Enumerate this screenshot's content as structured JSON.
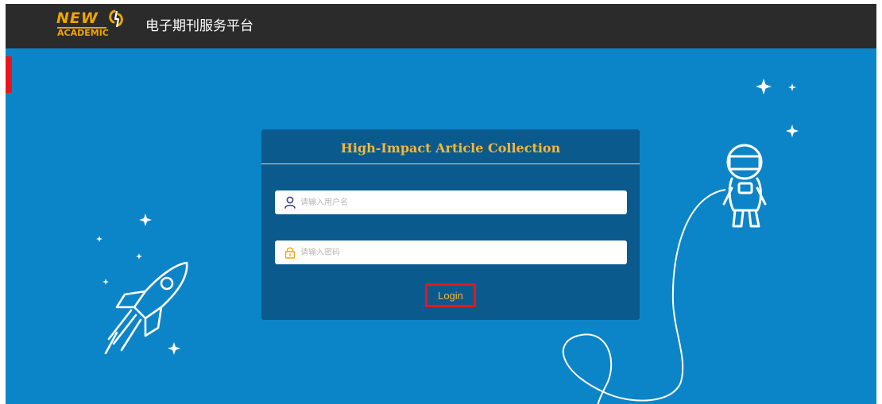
{
  "header": {
    "logo": {
      "line1": "NEW",
      "line2": "ACADEMIC"
    },
    "site_title": "电子期刊服务平台"
  },
  "login": {
    "title": "High-Impact Article Collection",
    "username": {
      "placeholder": "请输入用户名",
      "value": "",
      "icon": "user-icon"
    },
    "password": {
      "placeholder": "请输入密码",
      "value": "",
      "icon": "lock-icon"
    },
    "submit_label": "Login"
  },
  "colors": {
    "header_bg": "#2b2b2b",
    "page_bg": "#0c85c8",
    "card_bg": "#0b5a8d",
    "accent_gold": "#f4b63c",
    "highlight_red": "#e8151b"
  },
  "icons": [
    "rocket-icon",
    "astronaut-icon",
    "sparkle-icon",
    "user-icon",
    "lock-icon"
  ]
}
